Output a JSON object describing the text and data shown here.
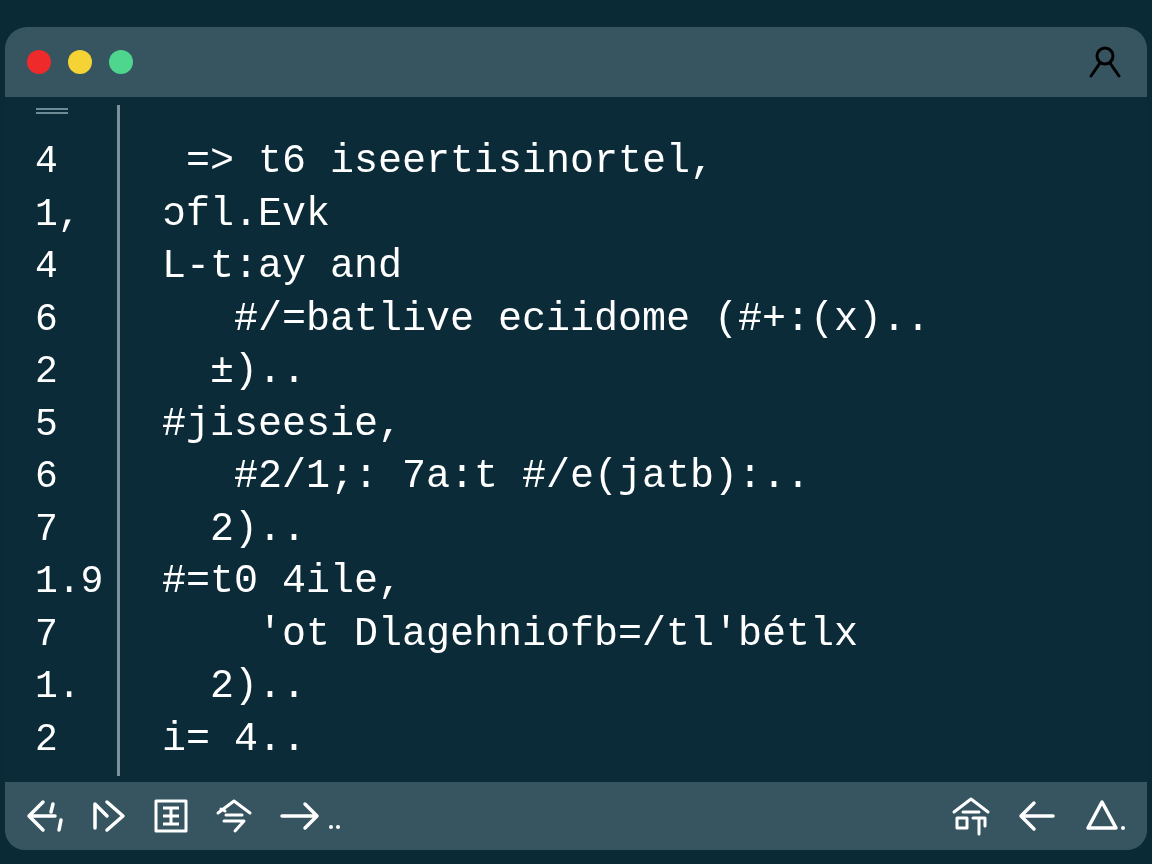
{
  "window_controls": [
    {
      "color": "#ee2a2a"
    },
    {
      "color": "#f5d334"
    },
    {
      "color": "#4fd68e"
    }
  ],
  "editor": {
    "lines": [
      {
        "number": "4",
        "code": " => t6 iseertisinortel,"
      },
      {
        "number": "1,",
        "code": "ɔfl.Evk"
      },
      {
        "number": "4",
        "code": "L-t:ay and"
      },
      {
        "number": "6",
        "code": "   #/=batlive eciidome (#+:(x).."
      },
      {
        "number": "2",
        "code": "  ±).."
      },
      {
        "number": "5",
        "code": "#jiseesie,"
      },
      {
        "number": "6",
        "code": "   #2/1;: 7a:t #/e(jatb):.."
      },
      {
        "number": "7",
        "code": "  2).."
      },
      {
        "number": "1.9",
        "code": "#=t0 4ile,"
      },
      {
        "number": "7",
        "code": "    'ot Dlagehniofb=/tl'bétlx"
      },
      {
        "number": "1.",
        "code": "  2).."
      },
      {
        "number": "2",
        "code": "i= 4.."
      }
    ]
  }
}
